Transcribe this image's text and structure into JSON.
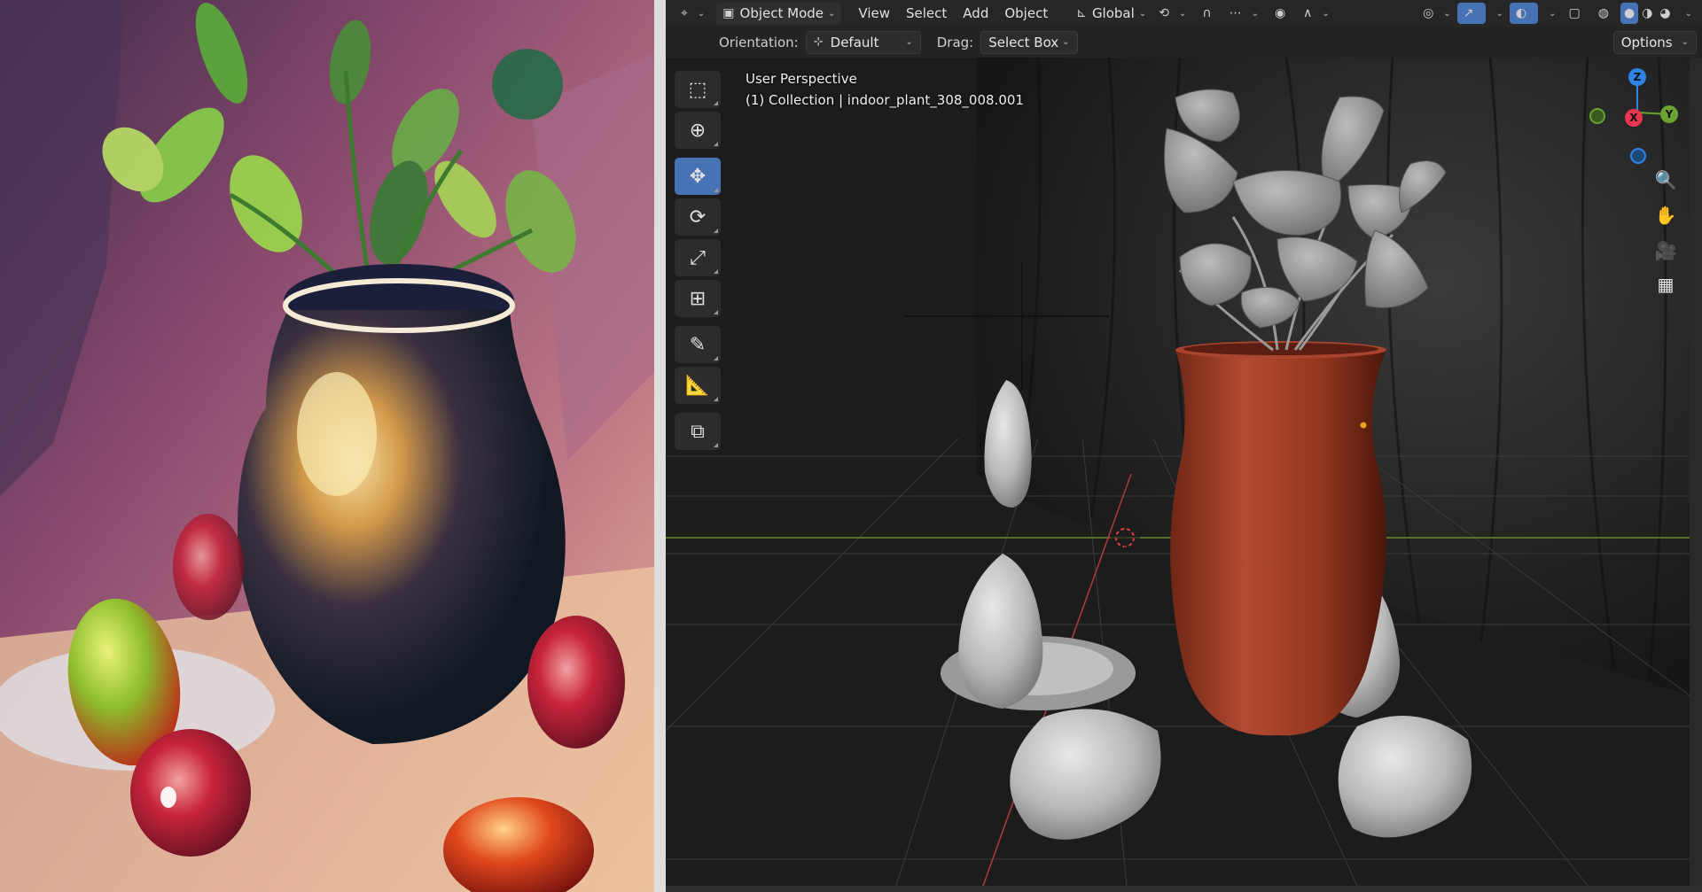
{
  "header": {
    "editor_icon": "editor-type-icon",
    "mode_label": "Object Mode",
    "menus": [
      "View",
      "Select",
      "Add",
      "Object"
    ],
    "transform_label": "Global"
  },
  "subheader": {
    "orientation_label": "Orientation:",
    "orientation_value": "Default",
    "drag_label": "Drag:",
    "drag_value": "Select Box",
    "options_label": "Options"
  },
  "viewport": {
    "view_name": "User Perspective",
    "collection_info": "(1) Collection | indoor_plant_308_008.001"
  },
  "toolbar": {
    "tools": [
      "select-box",
      "cursor",
      "move",
      "rotate",
      "scale",
      "transform",
      "annotate",
      "measure",
      "add-cube"
    ],
    "active_tool": "move"
  },
  "gizmo": {
    "axes": [
      "Z",
      "X",
      "Y"
    ],
    "colors": {
      "x": "#e8364f",
      "y": "#6aa331",
      "z": "#2f83e3"
    }
  },
  "colors": {
    "accent": "#4772b3",
    "vase": "#9c3a24",
    "x_axis_line": "#b03a3a",
    "y_axis_line": "#6a8a2a"
  }
}
